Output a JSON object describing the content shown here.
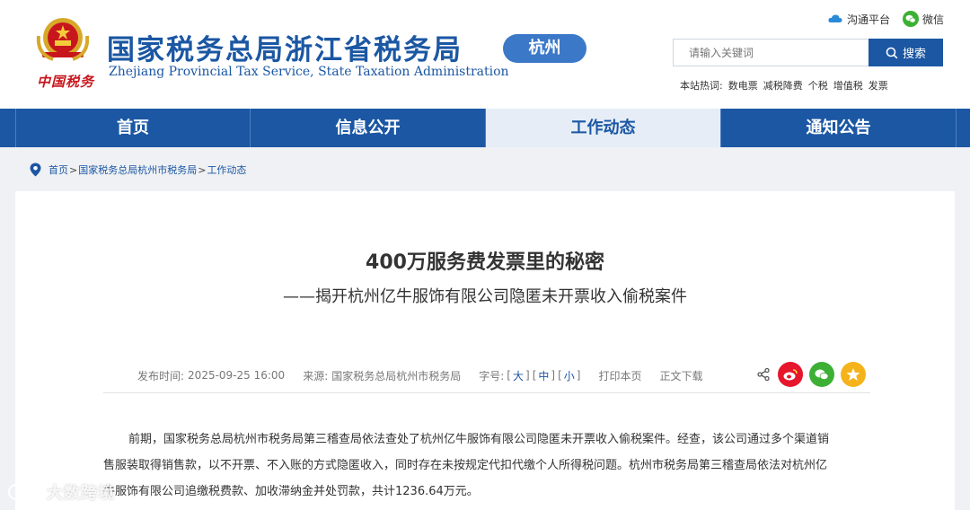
{
  "header": {
    "emblem_text": "中国税务",
    "title": "国家税务总局浙江省税务局",
    "subtitle": "Zhejiang Provincial Tax Service, State Taxation Administration",
    "city_badge": "杭州",
    "links": [
      {
        "label": "沟通平台",
        "icon": "cloud-icon"
      },
      {
        "label": "微信",
        "icon": "wechat-icon"
      }
    ],
    "search": {
      "placeholder": "请输入关键词",
      "button_label": "搜索"
    },
    "hot": {
      "label": "本站热词:",
      "words": [
        "数电票",
        "减税降费",
        "个税",
        "增值税",
        "发票"
      ]
    }
  },
  "nav": {
    "items": [
      {
        "label": "首页",
        "active": false
      },
      {
        "label": "信息公开",
        "active": false
      },
      {
        "label": "工作动态",
        "active": true
      },
      {
        "label": "通知公告",
        "active": false
      }
    ]
  },
  "breadcrumb": {
    "items": [
      "首页",
      "国家税务总局杭州市税务局",
      "工作动态"
    ],
    "separator": ">"
  },
  "article": {
    "title": "400万服务费发票里的秘密",
    "subtitle": "——揭开杭州亿牛服饰有限公司隐匿未开票收入偷税案件",
    "meta": {
      "published_label": "发布时间:",
      "published_value": "2025-09-25  16:00",
      "source_label": "来源:",
      "source_value": "国家税务总局杭州市税务局",
      "fontsize_label": "字号:",
      "font_large": "大",
      "font_medium": "中",
      "font_small": "小",
      "print_label": "打印本页",
      "download_label": "正文下载"
    },
    "share_icons": [
      "share-icon",
      "weibo-icon",
      "wechat-icon",
      "qzone-icon"
    ],
    "paragraph_lines": [
      "前期，国家税务总局杭州市税务局第三稽查局依法查处了杭州亿牛服饰有限公司隐匿未开票收入偷税案件。经查，该公司通过多个渠道销",
      "售服装取得销售款，以不开票、不入账的方式隐匿收入，同时存在未按规定代扣代缴个人所得税问题。杭州市税务局第三稽查局依法对杭州亿",
      "牛服饰有限公司追缴税费款、加收滞纳金并处罚款，共计1236.64万元。"
    ]
  },
  "watermark": {
    "text": "大数跨境"
  },
  "colors": {
    "brand_blue": "#1b57a3",
    "badge_blue": "#3b78c8",
    "nav_active_bg": "#e6edf7",
    "weibo_red": "#e6162d",
    "wechat_green": "#3cb034",
    "qzone_yellow": "#f5b31b"
  }
}
